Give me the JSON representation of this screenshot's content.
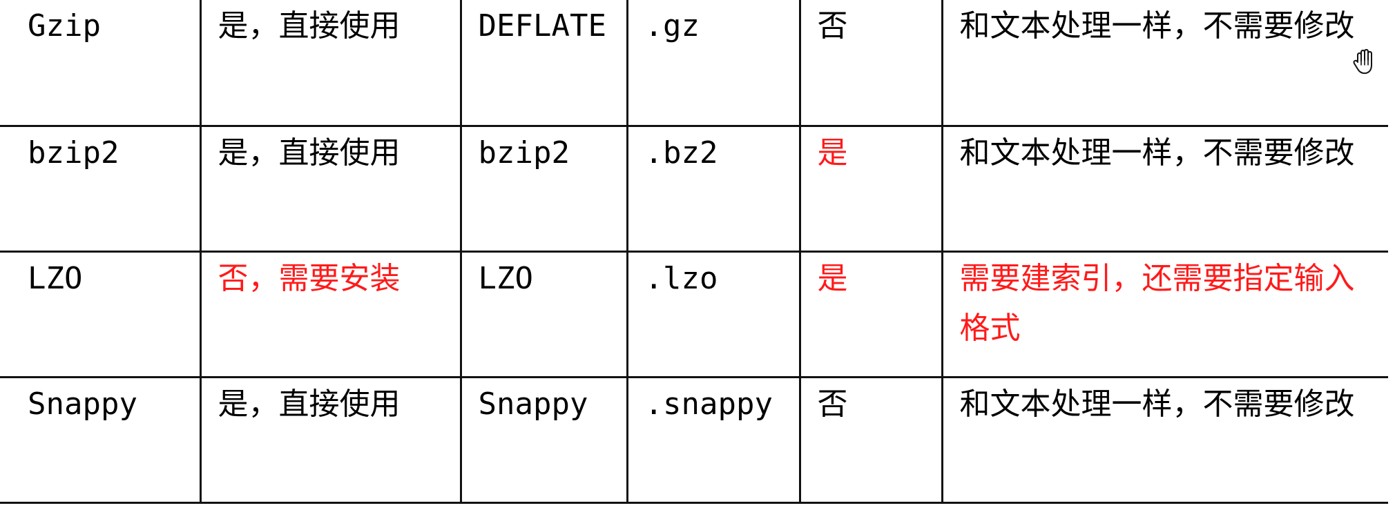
{
  "table": {
    "rows": [
      {
        "format": "Gzip",
        "hadoop_native": "是，直接使用",
        "algorithm": "DEFLATE",
        "extension": ".gz",
        "splittable": "否",
        "program_change": "和文本处理一样，不需要修改",
        "highlight": {
          "hadoop_native": false,
          "splittable": false,
          "program_change": false
        }
      },
      {
        "format": "bzip2",
        "hadoop_native": "是，直接使用",
        "algorithm": "bzip2",
        "extension": ".bz2",
        "splittable": "是",
        "program_change": "和文本处理一样，不需要修改",
        "highlight": {
          "hadoop_native": false,
          "splittable": true,
          "program_change": false
        }
      },
      {
        "format": "LZO",
        "hadoop_native": "否，需要安装",
        "algorithm": "LZO",
        "extension": ".lzo",
        "splittable": "是",
        "program_change": "需要建索引，还需要指定输入格式",
        "highlight": {
          "hadoop_native": true,
          "splittable": true,
          "program_change": true
        }
      },
      {
        "format": "Snappy",
        "hadoop_native": "是，直接使用",
        "algorithm": "Snappy",
        "extension": ".snappy",
        "splittable": "否",
        "program_change": "和文本处理一样，不需要修改",
        "highlight": {
          "hadoop_native": false,
          "splittable": false,
          "program_change": false
        }
      }
    ]
  },
  "colors": {
    "text": "#000000",
    "highlight": "#ff1a1a",
    "border": "#111111"
  },
  "cursor": {
    "icon": "hand-cursor-icon"
  }
}
